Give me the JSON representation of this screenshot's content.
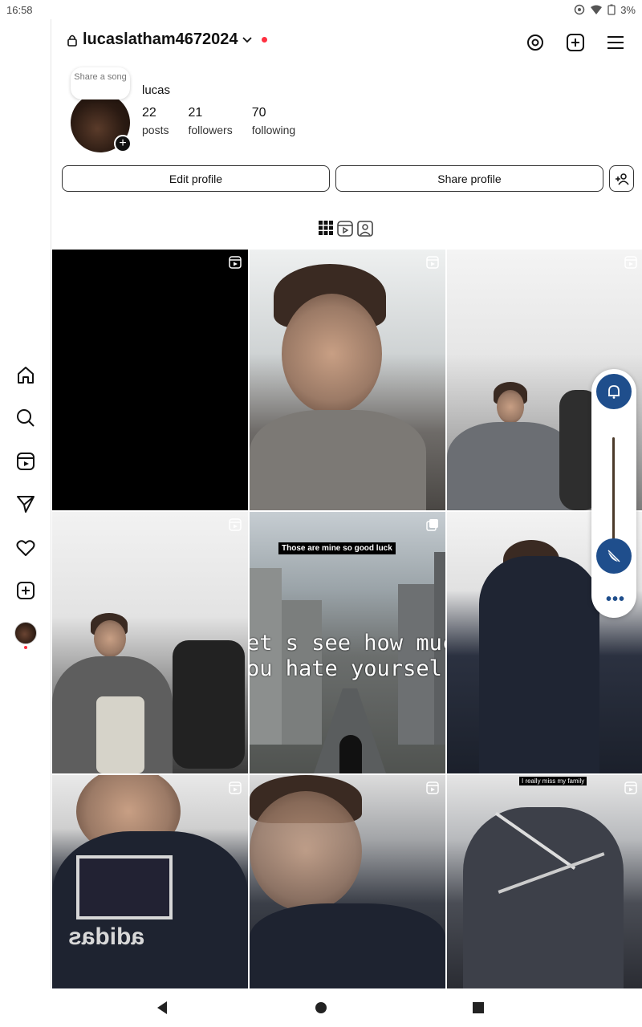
{
  "status_bar": {
    "time": "16:58",
    "battery": "3%"
  },
  "header": {
    "username": "lucaslatham4672024"
  },
  "profile": {
    "note_bubble": "Share a song",
    "full_name": "lucas",
    "stats": [
      {
        "value": "22",
        "label": "posts"
      },
      {
        "value": "21",
        "label": "followers"
      },
      {
        "value": "70",
        "label": "following"
      }
    ],
    "edit_button": "Edit profile",
    "share_button": "Share profile"
  },
  "tabs": [
    {
      "icon": "grid-icon"
    },
    {
      "icon": "reels-icon"
    },
    {
      "icon": "tagged-icon"
    }
  ],
  "grid": {
    "post5_caption": "Those are mine so good luck",
    "post5_text_line1": "et s see how muc",
    "post5_text_line2": "ou hate yoursel",
    "post6_caption": "I really miss my family",
    "post7_logo_text": "adidas"
  },
  "sidebar_icons": [
    "home-icon",
    "search-icon",
    "reels-icon",
    "messages-icon",
    "notifications-icon",
    "create-icon",
    "profile-avatar"
  ],
  "colors": {
    "accent": "#1f4e8c",
    "notification": "#ff3040"
  }
}
